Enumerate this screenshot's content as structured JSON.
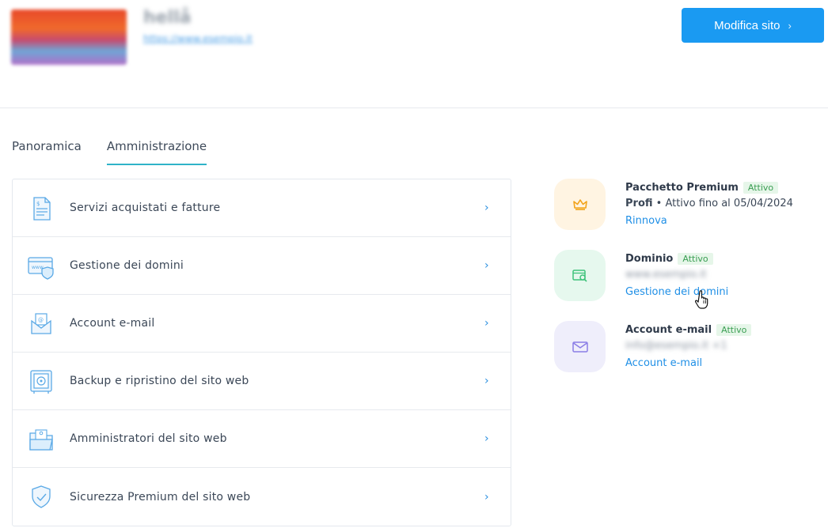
{
  "header": {
    "site_name": "hellå",
    "site_url": "https://www.esempio.it",
    "edit_button": "Modifica sito",
    "edit_chevron": "›"
  },
  "tabs": [
    {
      "label": "Panoramica",
      "active": false
    },
    {
      "label": "Amministrazione",
      "active": true
    }
  ],
  "menu": {
    "items": [
      {
        "label": "Servizi acquistati e fatture",
        "icon": "invoice-icon"
      },
      {
        "label": "Gestione dei domini",
        "icon": "domain-shield-icon"
      },
      {
        "label": "Account e-mail",
        "icon": "email-envelope-icon"
      },
      {
        "label": "Backup e ripristino del sito web",
        "icon": "safe-icon"
      },
      {
        "label": "Amministratori del sito web",
        "icon": "admin-folder-icon"
      },
      {
        "label": "Sicurezza Premium del sito web",
        "icon": "security-shield-icon"
      }
    ],
    "chevron": "›"
  },
  "cards": {
    "package": {
      "title": "Pacchetto Premium",
      "badge": "Attivo",
      "plan": "Profi",
      "bullet": " • ",
      "active_until": "Attivo fino al 05/04/2024",
      "link": "Rinnova",
      "icon": "crown-icon"
    },
    "domain": {
      "title": "Dominio",
      "badge": "Attivo",
      "value": "www.esempio.it",
      "link": "Gestione dei domini",
      "icon": "domain-search-icon"
    },
    "email": {
      "title": "Account e-mail",
      "badge": "Attivo",
      "value": "info@esempio.it +1",
      "link": "Account e-mail",
      "icon": "mail-icon"
    }
  },
  "colors": {
    "accent": "#1a9af2",
    "tab_underline": "#2fb3c8",
    "badge_green": "#3a9e52",
    "link": "#1f8fe6"
  }
}
